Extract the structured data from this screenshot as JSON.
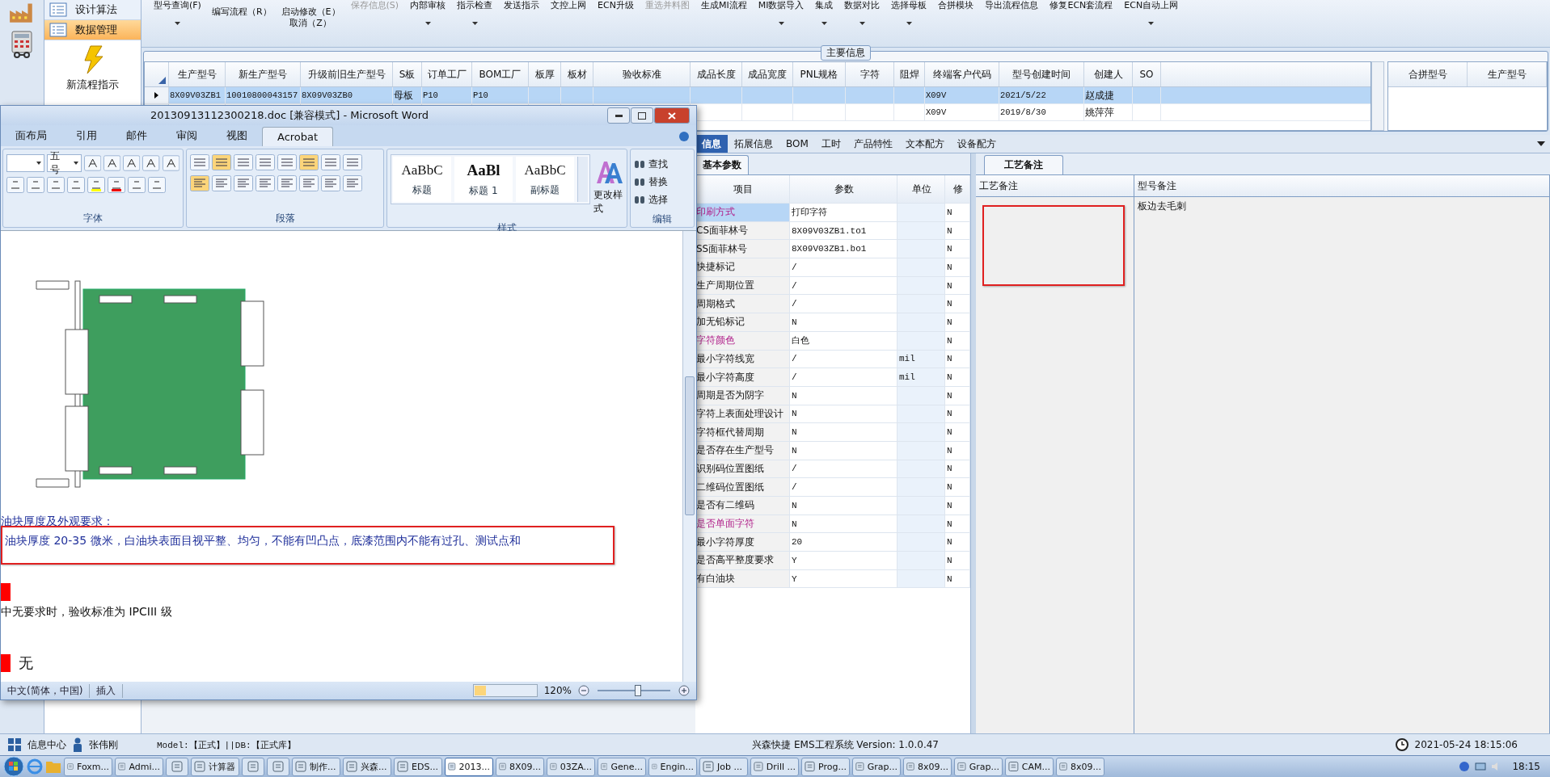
{
  "toolbar": [
    {
      "kind": "button",
      "label": "型号查询(F)",
      "dropdown": true,
      "disabled": false
    },
    {
      "kind": "stack",
      "lines": [
        "编写流程（R）"
      ]
    },
    {
      "kind": "stack",
      "lines": [
        "启动修改（E）",
        "取消（Z）"
      ]
    },
    {
      "kind": "button",
      "label": "保存信息(S)",
      "dropdown": false,
      "disabled": true
    },
    {
      "kind": "button",
      "label": "内部审核",
      "dropdown": true,
      "disabled": false
    },
    {
      "kind": "button",
      "label": "指示检查",
      "dropdown": true,
      "disabled": false
    },
    {
      "kind": "button",
      "label": "发送指示",
      "dropdown": false,
      "disabled": false
    },
    {
      "kind": "button",
      "label": "文控上网",
      "dropdown": false,
      "disabled": false
    },
    {
      "kind": "button",
      "label": "ECN升级",
      "dropdown": false,
      "disabled": false
    },
    {
      "kind": "button",
      "label": "重选并料图",
      "dropdown": false,
      "disabled": true
    },
    {
      "kind": "button",
      "label": "生成MI流程",
      "dropdown": false,
      "disabled": false
    },
    {
      "kind": "button",
      "label": "MI数据导入",
      "dropdown": true,
      "disabled": false
    },
    {
      "kind": "button",
      "label": "集成",
      "dropdown": true,
      "disabled": false
    },
    {
      "kind": "button",
      "label": "数据对比",
      "dropdown": true,
      "disabled": false
    },
    {
      "kind": "button",
      "label": "选择母板",
      "dropdown": true,
      "disabled": false
    },
    {
      "kind": "button",
      "label": "合拼模块",
      "dropdown": false,
      "disabled": false
    },
    {
      "kind": "button",
      "label": "导出流程信息",
      "dropdown": false,
      "disabled": false
    },
    {
      "kind": "button",
      "label": "修复ECN套流程",
      "dropdown": false,
      "disabled": false
    },
    {
      "kind": "button",
      "label": "ECN自动上网",
      "dropdown": true,
      "disabled": false
    }
  ],
  "nav": [
    {
      "kind": "list",
      "label": "设计算法",
      "selected": false
    },
    {
      "kind": "list",
      "label": "数据管理",
      "selected": true
    },
    {
      "kind": "big",
      "label": "新流程指示",
      "selected": false
    }
  ],
  "info": {
    "title": "主要信息",
    "columns": [
      "生产型号",
      "新生产型号",
      "升级前旧生产型号",
      "S板",
      "订单工厂",
      "BOM工厂",
      "板厚",
      "板材",
      "验收标准",
      "成品长度",
      "成品宽度",
      "PNL规格",
      "字符",
      "阻焊",
      "终端客户代码",
      "型号创建时间",
      "创建人",
      "SO"
    ],
    "rows": [
      {
        "selected": true,
        "cells": [
          "8X09V03ZB1",
          "10010800043157",
          "8X09V03ZB0",
          "母板",
          "P10",
          "P10"
        ],
        "customer_cells": [
          "X09V",
          "2021/5/22",
          "赵成捷"
        ]
      },
      {
        "selected": false,
        "customer_cells": [
          "X09V",
          "2019/8/30",
          "姚萍萍"
        ]
      }
    ],
    "merge_columns": [
      "合拼型号",
      "生产型号"
    ]
  },
  "tabs": [
    {
      "label": "信息",
      "selected": true
    },
    {
      "label": "拓展信息",
      "selected": false
    },
    {
      "label": "BOM",
      "selected": false
    },
    {
      "label": "工时",
      "selected": false
    },
    {
      "label": "产品特性",
      "selected": false
    },
    {
      "label": "文本配方",
      "selected": false
    },
    {
      "label": "设备配方",
      "selected": false
    }
  ],
  "params": {
    "tab": "基本参数",
    "columns": [
      "项目",
      "参数",
      "单位",
      "修"
    ],
    "rows": [
      {
        "item": "印刷方式",
        "value": "打印字符",
        "flag": "N",
        "highlighted": true,
        "selected": true
      },
      {
        "item": "CS面菲林号",
        "value": "8X09V03ZB1.to1",
        "flag": "N",
        "highlighted": false,
        "selected": false
      },
      {
        "item": "SS面菲林号",
        "value": "8X09V03ZB1.bo1",
        "flag": "N",
        "highlighted": false,
        "selected": false
      },
      {
        "item": "快捷标记",
        "value": "/",
        "flag": "N",
        "highlighted": false,
        "selected": false
      },
      {
        "item": "生产周期位置",
        "value": "/",
        "flag": "N",
        "highlighted": false,
        "selected": false
      },
      {
        "item": "周期格式",
        "value": "/",
        "flag": "N",
        "highlighted": false,
        "selected": false
      },
      {
        "item": "加无铅标记",
        "value": "N",
        "flag": "N",
        "highlighted": false,
        "selected": false
      },
      {
        "item": "字符颜色",
        "value": "白色",
        "flag": "N",
        "highlighted": true,
        "selected": false
      },
      {
        "item": "最小字符线宽",
        "value": "/",
        "unit": "mil",
        "flag": "N",
        "highlighted": false,
        "selected": false
      },
      {
        "item": "最小字符高度",
        "value": "/",
        "unit": "mil",
        "flag": "N",
        "highlighted": false,
        "selected": false
      },
      {
        "item": "周期是否为阴字",
        "value": "N",
        "flag": "N",
        "highlighted": false,
        "selected": false
      },
      {
        "item": "字符上表面处理设计",
        "value": "N",
        "flag": "N",
        "highlighted": false,
        "selected": false
      },
      {
        "item": "字符框代替周期",
        "value": "N",
        "flag": "N",
        "highlighted": false,
        "selected": false
      },
      {
        "item": "是否存在生产型号",
        "value": "N",
        "flag": "N",
        "highlighted": false,
        "selected": false
      },
      {
        "item": "识别码位置图纸",
        "value": "/",
        "flag": "N",
        "highlighted": false,
        "selected": false
      },
      {
        "item": "二维码位置图纸",
        "value": "/",
        "flag": "N",
        "highlighted": false,
        "selected": false
      },
      {
        "item": "是否有二维码",
        "value": "N",
        "flag": "N",
        "highlighted": false,
        "selected": false
      },
      {
        "item": "是否单面字符",
        "value": "N",
        "flag": "N",
        "highlighted": true,
        "selected": false
      },
      {
        "item": "最小字符厚度",
        "value": "20",
        "flag": "N",
        "highlighted": false,
        "selected": false
      },
      {
        "item": "是否高平整度要求",
        "value": "Y",
        "flag": "N",
        "highlighted": false,
        "selected": false
      },
      {
        "item": "有白油块",
        "value": "Y",
        "flag": "N",
        "highlighted": false,
        "selected": false
      }
    ]
  },
  "notes": {
    "tab": "工艺备注",
    "columns": [
      "工艺备注",
      "型号备注"
    ],
    "process_note_boxed": true,
    "model_note": "板边去毛刺"
  },
  "word": {
    "title": "20130913112300218.doc [兼容模式] - Microsoft Word",
    "tabs": [
      {
        "label": "面布局",
        "selected": false
      },
      {
        "label": "引用",
        "selected": false
      },
      {
        "label": "邮件",
        "selected": false
      },
      {
        "label": "审阅",
        "selected": false
      },
      {
        "label": "视图",
        "selected": false
      },
      {
        "label": "Acrobat",
        "selected": true
      }
    ],
    "font_size": "五号",
    "groups": [
      "字体",
      "段落",
      "样式",
      "编辑"
    ],
    "paragraph_buttons": [
      {
        "on": false
      },
      {
        "on": true
      },
      {
        "on": false
      },
      {
        "on": false
      },
      {
        "on": false
      },
      {
        "on": true
      },
      {
        "on": false
      },
      {
        "on": false
      },
      {
        "on": true
      },
      {
        "on": false
      },
      {
        "on": false
      },
      {
        "on": false
      },
      {
        "on": false
      },
      {
        "on": false
      },
      {
        "on": false
      },
      {
        "on": false
      }
    ],
    "styles": [
      {
        "preview": "AaBbC",
        "label": "标题",
        "kind": "normal"
      },
      {
        "preview": "AaBl",
        "label": "标题 1",
        "kind": "heading"
      },
      {
        "preview": "AaBbC",
        "label": "副标题",
        "kind": "normal"
      }
    ],
    "change_styles": "更改样式",
    "edit_actions": [
      "查找",
      "替换",
      "选择"
    ],
    "doc": [
      {
        "kind": "figure"
      },
      {
        "kind": "blue",
        "text": "油块厚度及外观要求：",
        "boxed": false
      },
      {
        "kind": "blue",
        "text": "油块厚度 20-35 微米，白油块表面目视平整、均匀，不能有凹凸点，底漆范围内不能有过孔、测试点和",
        "boxed": true
      },
      {
        "kind": "marker"
      },
      {
        "kind": "plain",
        "text": "中无要求时，验收标准为 IPCIII 级"
      },
      {
        "kind": "marker",
        "text": "无"
      }
    ],
    "status": {
      "language": "中文(简体，中国)",
      "mode": "插入",
      "zoom": "120%",
      "level": 0.55
    }
  },
  "status": {
    "info_center": "信息中心",
    "user": "张伟刚",
    "env": "Model:【正式】||DB:【正式库】",
    "app": "兴森快捷 EMS工程系统 Version: 1.0.0.47",
    "datetime": "2021-05-24 18:15:06"
  },
  "taskbar": {
    "items": [
      {
        "label": "Foxm...",
        "selected": false
      },
      {
        "label": "Admi...",
        "selected": false
      },
      {
        "selected": false
      },
      {
        "label": "计算器",
        "selected": false
      },
      {
        "selected": false
      },
      {
        "selected": false
      },
      {
        "label": "制作...",
        "selected": false
      },
      {
        "label": "兴森...",
        "selected": false
      },
      {
        "label": "EDS...",
        "selected": false
      },
      {
        "label": "2013...",
        "selected": true
      },
      {
        "label": "8X09...",
        "selected": false
      },
      {
        "label": "03ZA...",
        "selected": false
      },
      {
        "label": "Gene...",
        "selected": false
      },
      {
        "label": "Engin...",
        "selected": false
      },
      {
        "label": "Job ...",
        "selected": false
      },
      {
        "label": "Drill ...",
        "selected": false
      },
      {
        "label": "Prog...",
        "selected": false
      },
      {
        "label": "Grap...",
        "selected": false
      },
      {
        "label": "8x09...",
        "selected": false
      },
      {
        "label": "Grap...",
        "selected": false
      },
      {
        "label": "CAM...",
        "selected": false
      },
      {
        "label": "8x09...",
        "selected": false
      }
    ],
    "clock": "18:15"
  }
}
